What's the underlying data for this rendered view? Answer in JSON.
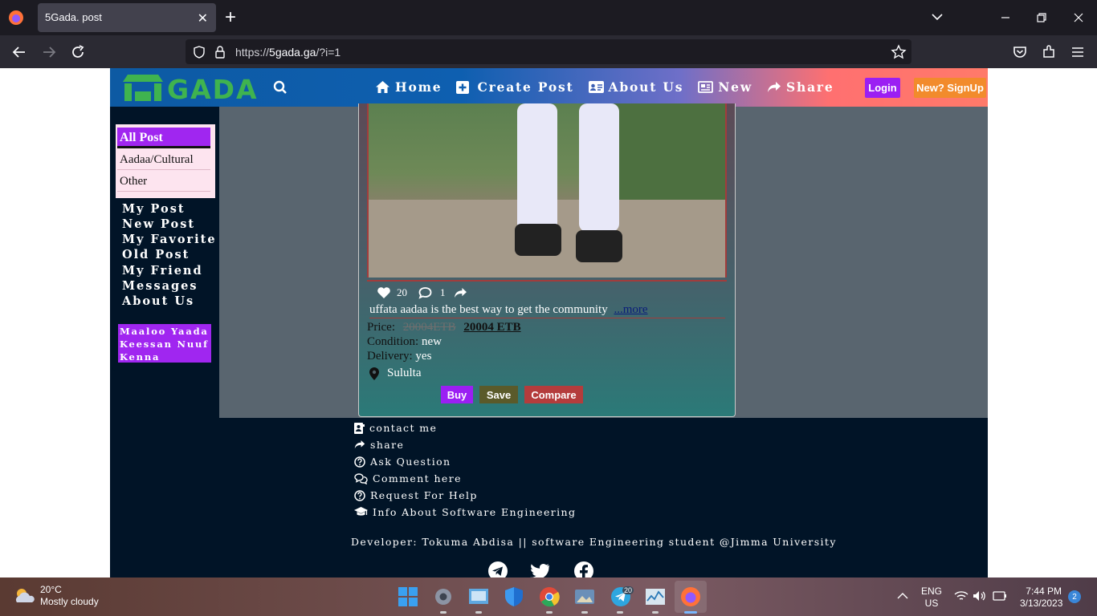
{
  "browser": {
    "tab_title": "5Gada. post",
    "url_protocol": "https://",
    "url_host": "5gada.ga",
    "url_path": "/?i=1"
  },
  "site": {
    "logo_text": "GADA",
    "nav": [
      {
        "label": "Home",
        "icon": "home-icon"
      },
      {
        "label": "Create Post",
        "icon": "plus-square-icon"
      },
      {
        "label": "About Us",
        "icon": "id-card-icon"
      },
      {
        "label": "New",
        "icon": "newspaper-icon"
      },
      {
        "label": "Share",
        "icon": "share-icon"
      }
    ],
    "login_label": "Login",
    "signup_label": "New? SignUp"
  },
  "sidebar": {
    "categories": [
      "All Post",
      "Aadaa/Cultural",
      "Other"
    ],
    "links": [
      "My Post",
      "New Post",
      "My Favorite",
      "Old Post",
      "My Friend",
      "Messages",
      "About Us"
    ],
    "promo": "Maaloo Yaada Keessan Nuuf Kenna"
  },
  "post": {
    "likes": "20",
    "comments": "1",
    "description": "uffata aadaa is the best way to get the community",
    "more_label": "...more",
    "price_label": "Price:",
    "old_price": "20004ETB",
    "new_price": "20004 ETB",
    "condition_label": "Condition:",
    "condition_value": "new",
    "delivery_label": "Delivery:",
    "delivery_value": "yes",
    "location": "Sululta",
    "buy_label": "Buy",
    "save_label": "Save",
    "compare_label": "Compare",
    "buy_color": "#9b1ff3",
    "save_color": "#5a5a2a",
    "compare_color": "#b43c3c"
  },
  "footer": {
    "links": [
      {
        "label": "contact me",
        "icon": "contact-icon"
      },
      {
        "label": "share",
        "icon": "share-icon"
      },
      {
        "label": "Ask Question",
        "icon": "question-icon"
      },
      {
        "label": "Comment here",
        "icon": "comments-icon"
      },
      {
        "label": "Request For Help",
        "icon": "question-icon"
      },
      {
        "label": "Info About Software Engineering",
        "icon": "graduation-cap-icon"
      }
    ],
    "developer": "Developer: Tokuma Abdisa || software Engineering student @Jimma University"
  },
  "taskbar": {
    "temp": "20°C",
    "condition": "Mostly cloudy",
    "lang1": "ENG",
    "lang2": "US",
    "time": "7:44 PM",
    "date": "3/13/2023",
    "notifications": "2",
    "telegram_badge": "20"
  }
}
